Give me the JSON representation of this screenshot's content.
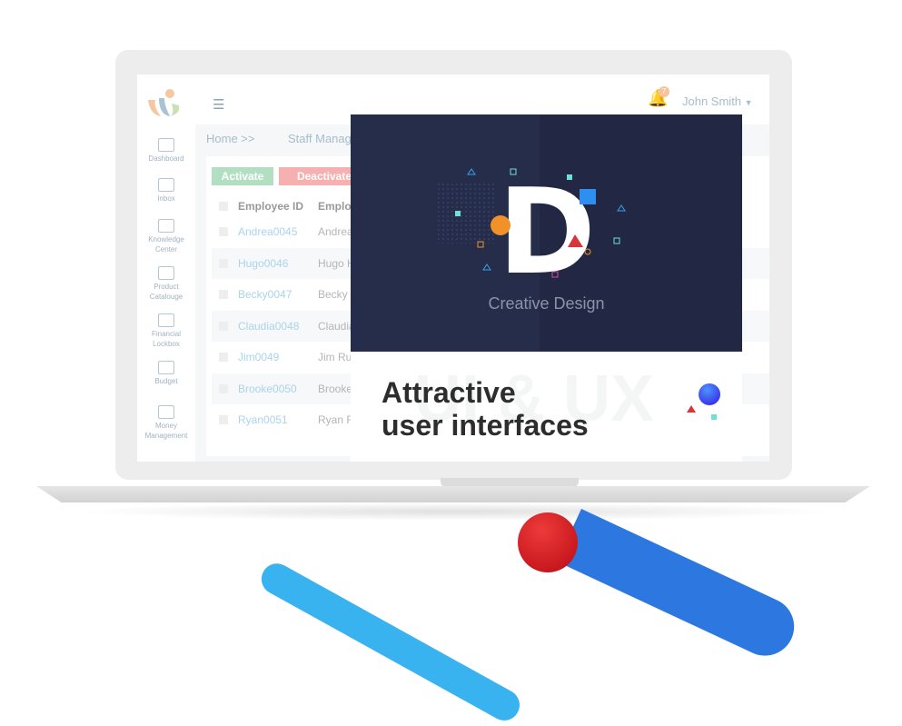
{
  "app": {
    "user_name": "John Smith",
    "notification_count": "7",
    "menu_icon": "hamburger-icon"
  },
  "sidebar": {
    "items": [
      {
        "label": "Dashboard",
        "icon": "monitor-icon"
      },
      {
        "label": "Inbox",
        "icon": "inbox-icon"
      },
      {
        "label": "Knowledge Center",
        "icon": "books-icon"
      },
      {
        "label": "Product Catalouge",
        "icon": "catalogue-icon"
      },
      {
        "label": "Financial Lockbox",
        "icon": "safe-icon"
      },
      {
        "label": "Budget",
        "icon": "money-bag-icon"
      },
      {
        "label": "Money Management",
        "icon": "wallet-icon"
      }
    ]
  },
  "breadcrumb": {
    "home": "Home >>",
    "current": "Staff Manag"
  },
  "actions": {
    "activate": "Activate",
    "deactivate": "Deactivate",
    "activate_color": "#b2dfc2",
    "deactivate_color": "#f6b0b0"
  },
  "table": {
    "headers": [
      "Employee ID",
      "Employ"
    ],
    "rows": [
      [
        "Andrea0045",
        "Andrea"
      ],
      [
        "Hugo0046",
        "Hugo H"
      ],
      [
        "Becky0047",
        "Becky"
      ],
      [
        "Claudia0048",
        "Claudia"
      ],
      [
        "Jim0049",
        "Jim Ru"
      ],
      [
        "Brooke0050",
        "Brooke"
      ],
      [
        "Ryan0051",
        "Ryan R"
      ]
    ]
  },
  "promo": {
    "letter": "D",
    "subtitle": "Creative Design",
    "watermark": "UI & UX",
    "headline_1": "Attractive",
    "headline_2": "user interfaces"
  }
}
